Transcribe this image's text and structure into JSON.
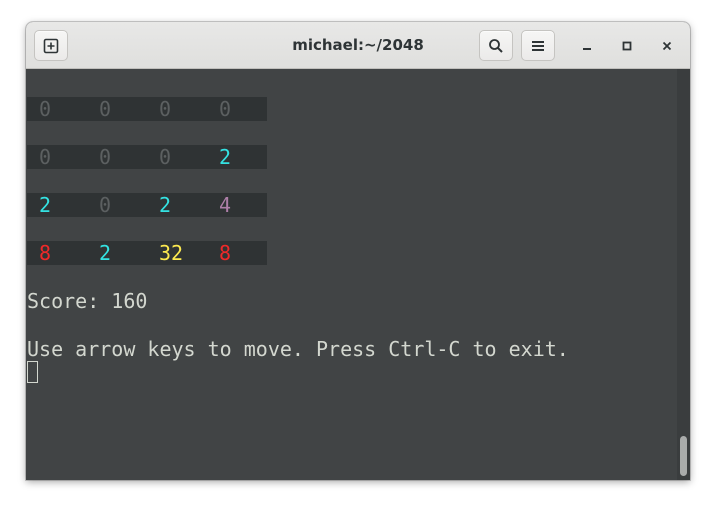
{
  "window": {
    "title": "michael:~/2048"
  },
  "icons": {
    "new_tab": "new-tab-icon",
    "search": "search-icon",
    "menu": "hamburger-menu-icon",
    "minimize": "minimize-icon",
    "maximize": "maximize-icon",
    "close": "close-icon"
  },
  "colors": {
    "terminal_bg": "#414445",
    "row_bg": "#2f3334",
    "text": "#d3d7cf",
    "tile_0": "#5c6061",
    "tile_2": "#34e2e2",
    "tile_4": "#ad7fa8",
    "tile_8": "#ef2929",
    "tile_32": "#fce94f"
  },
  "board": [
    [
      "0",
      "0",
      "0",
      "0"
    ],
    [
      "0",
      "0",
      "0",
      "2"
    ],
    [
      "2",
      "0",
      "2",
      "4"
    ],
    [
      "8",
      "2",
      "32",
      "8"
    ]
  ],
  "score_line": "Score: 160",
  "help_line": "Use arrow keys to move. Press Ctrl-C to exit."
}
